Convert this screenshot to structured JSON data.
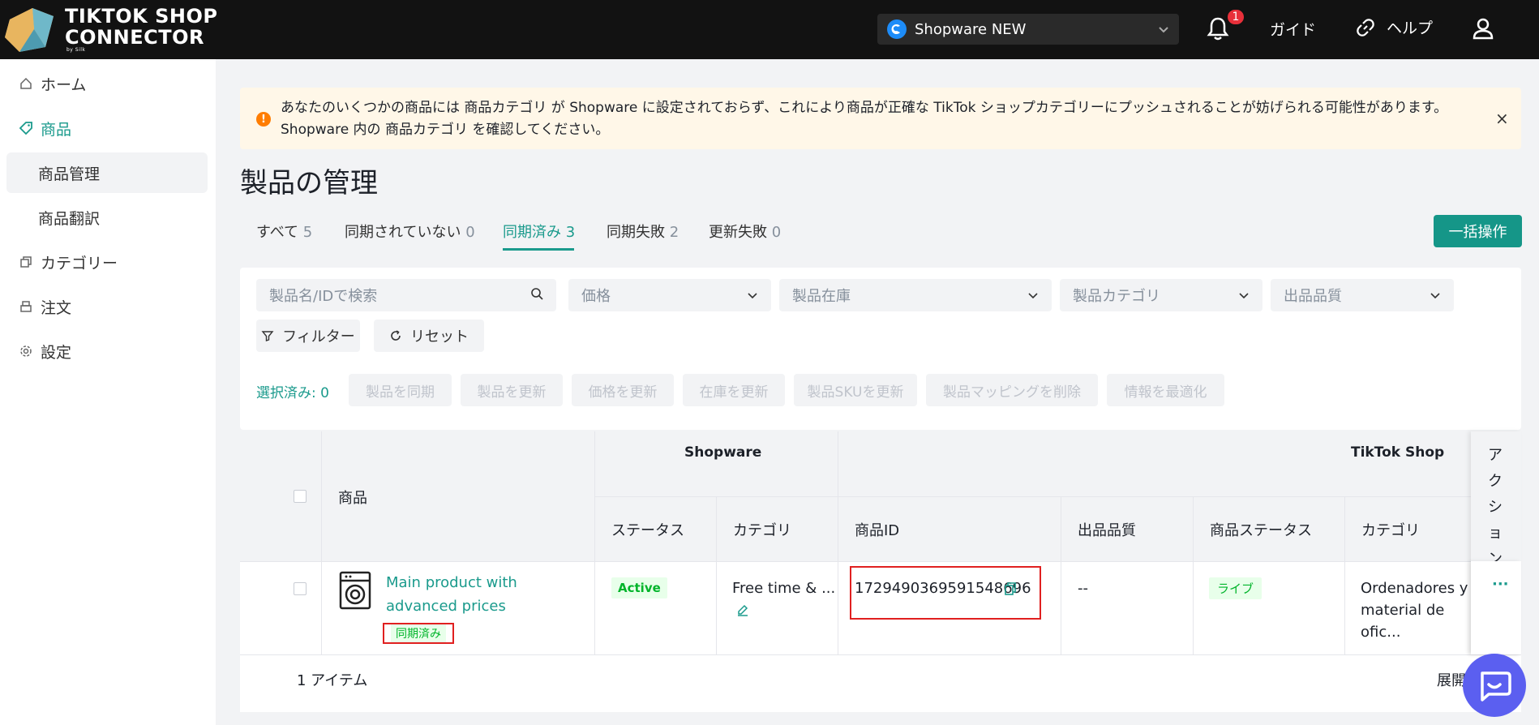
{
  "header": {
    "logo_line1": "TIKTOK SHOP",
    "logo_line2": "CONNECTOR",
    "logo_by": "by Silk",
    "store_name": "Shopware NEW",
    "notification_count": "1",
    "guide": "ガイド",
    "help": "ヘルプ"
  },
  "sidebar": {
    "home": "ホーム",
    "products": "商品",
    "product_manage": "商品管理",
    "product_translate": "商品翻訳",
    "category": "カテゴリー",
    "orders": "注文",
    "settings": "設定"
  },
  "alert": {
    "text": "あなたのいくつかの商品には 商品カテゴリ が Shopware に設定されておらず、これにより商品が正確な TikTok ショップカテゴリーにプッシュされることが妨げられる可能性があります。Shopware 内の 商品カテゴリ を確認してください。"
  },
  "page_title": "製品の管理",
  "tabs": [
    {
      "label": "すべて",
      "count": "5"
    },
    {
      "label": "同期されていない",
      "count": "0"
    },
    {
      "label": "同期済み",
      "count": "3"
    },
    {
      "label": "同期失敗",
      "count": "2"
    },
    {
      "label": "更新失敗",
      "count": "0"
    }
  ],
  "bulk_button": "一括操作",
  "filters": {
    "search_placeholder": "製品名/IDで検索",
    "price": "価格",
    "stock": "製品在庫",
    "category": "製品カテゴリ",
    "quality": "出品品質",
    "filter_btn": "フィルター",
    "reset_btn": "リセット"
  },
  "selection": {
    "selected": "選択済み: 0",
    "actions": [
      "製品を同期",
      "製品を更新",
      "価格を更新",
      "在庫を更新",
      "製品SKUを更新",
      "製品マッピングを削除",
      "情報を最適化"
    ]
  },
  "table": {
    "col_product": "商品",
    "group_shopware": "Shopware",
    "group_tiktok": "TikTok Shop",
    "col_action": "アクション",
    "col_status": "ステータス",
    "col_category": "カテゴリ",
    "col_product_id": "商品ID",
    "col_quality": "出品品質",
    "col_product_status": "商品ステータス",
    "col_tt_category": "カテゴリ",
    "row": {
      "name": "Main product with advanced prices",
      "sync_tag": "同期済み",
      "status": "Active",
      "category": "Free time & ...",
      "product_id": "1729490369591548696",
      "quality": "--",
      "product_status": "ライブ",
      "tt_category": "Ordenadores y material de ofic...",
      "more": "···"
    },
    "footer_count": "1 アイテム",
    "footer_expand": "展開"
  }
}
